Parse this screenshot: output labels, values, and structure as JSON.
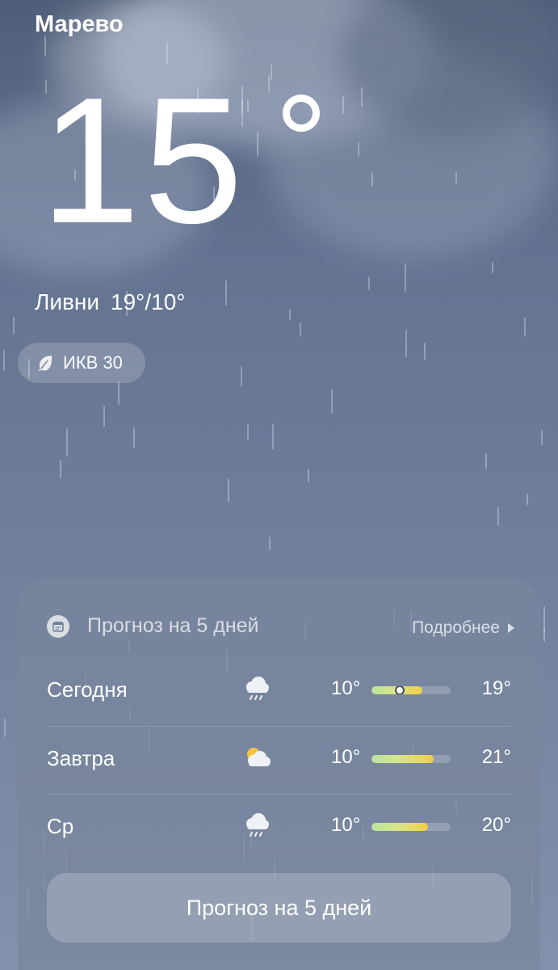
{
  "header": {
    "city": "Марево",
    "temperature": "15",
    "condition": "Ливни",
    "range": "19°/10°",
    "aqi_label": "ИКВ 30"
  },
  "forecast": {
    "title": "Прогноз на 5 дней",
    "more_label": "Подробнее",
    "days": [
      {
        "day": "Сегодня",
        "icon": "rain-cloud-icon",
        "low": "10°",
        "high": "19°",
        "bar_start": 0.0,
        "bar_end": 0.64,
        "current_marker": 0.34
      },
      {
        "day": "Завтра",
        "icon": "partly-sunny-icon",
        "low": "10°",
        "high": "21°",
        "bar_start": 0.0,
        "bar_end": 0.79
      },
      {
        "day": "Ср",
        "icon": "rain-cloud-icon",
        "low": "10°",
        "high": "20°",
        "bar_start": 0.0,
        "bar_end": 0.71
      }
    ],
    "button_label": "Прогноз на 5 дней"
  },
  "colors": {
    "bar_gradient_start": "#b8e3a0",
    "bar_gradient_end": "#f1cf45",
    "sun": "#f4c445"
  }
}
